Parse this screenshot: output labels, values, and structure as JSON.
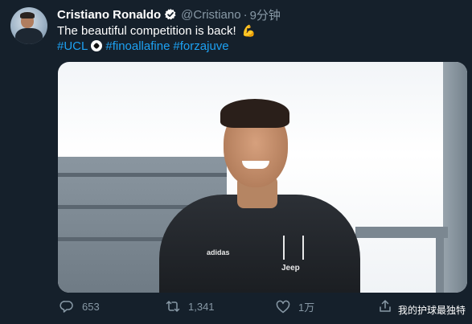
{
  "tweet": {
    "display_name": "Cristiano Ronaldo",
    "handle": "@Cristiano",
    "separator": "·",
    "time": "9分钟",
    "text": "The beautiful competition is back!",
    "emoji": "💪",
    "hashtags": [
      "#UCL",
      "#finoallafine",
      "#forzajuve"
    ]
  },
  "media": {
    "kit_sponsor": "Jeep",
    "kit_brand": "adidas"
  },
  "actions": {
    "replies": "653",
    "retweets": "1,341",
    "likes": "1万"
  },
  "watermark": "我的护球最独特",
  "colors": {
    "background": "#15202b",
    "text": "#ffffff",
    "muted": "#8899a6",
    "link": "#1da1f2",
    "verified": "#ffffff"
  },
  "icons": {
    "verified": "verified-badge-icon",
    "reply": "reply-icon",
    "retweet": "retweet-icon",
    "like": "heart-icon",
    "share": "share-icon"
  }
}
